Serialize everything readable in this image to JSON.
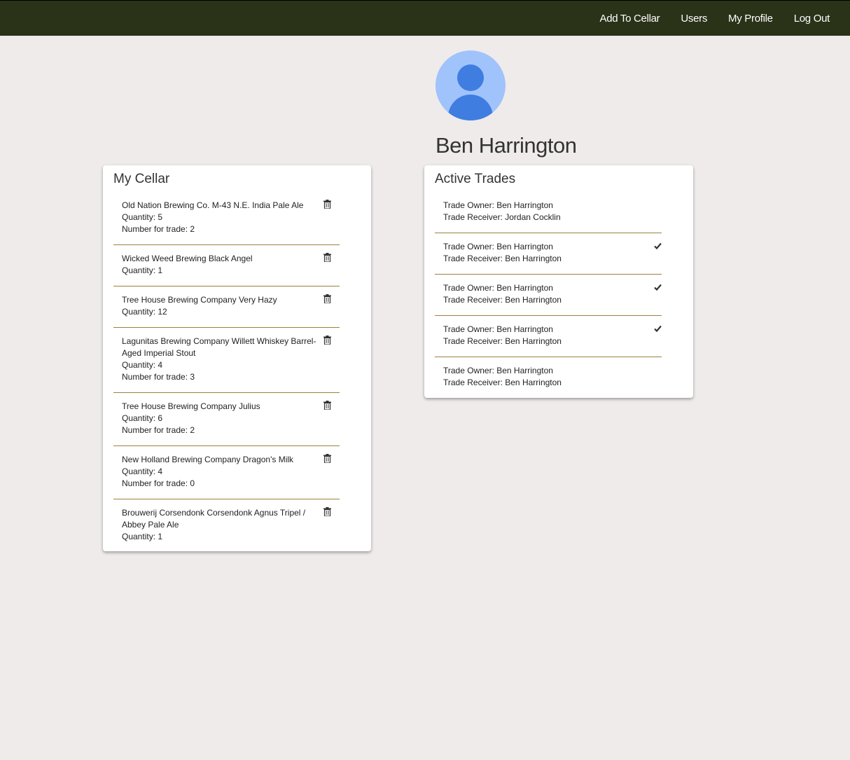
{
  "nav": {
    "links": [
      "Add To Cellar",
      "Users",
      "My Profile",
      "Log Out"
    ]
  },
  "profile": {
    "name": "Ben Harrington"
  },
  "cellar": {
    "title": "My Cellar",
    "items": [
      {
        "name": "Old Nation Brewing Co. M-43 N.E. India Pale Ale",
        "quantity": "Quantity: 5",
        "trade": "Number for trade: 2"
      },
      {
        "name": "Wicked Weed Brewing Black Angel",
        "quantity": "Quantity: 1",
        "trade": ""
      },
      {
        "name": "Tree House Brewing Company Very Hazy",
        "quantity": "Quantity: 12",
        "trade": ""
      },
      {
        "name": "Lagunitas Brewing Company Willett Whiskey Barrel-Aged Imperial Stout",
        "quantity": "Quantity: 4",
        "trade": "Number for trade: 3"
      },
      {
        "name": "Tree House Brewing Company Julius",
        "quantity": "Quantity: 6",
        "trade": "Number for trade: 2"
      },
      {
        "name": "New Holland Brewing Company Dragon's Milk",
        "quantity": "Quantity: 4",
        "trade": "Number for trade: 0"
      },
      {
        "name": "Brouwerij Corsendonk Corsendonk Agnus Tripel / Abbey Pale Ale",
        "quantity": "Quantity: 1",
        "trade": ""
      }
    ],
    "trash_icon": "trash-icon"
  },
  "trades": {
    "title": "Active Trades",
    "items": [
      {
        "owner": "Trade Owner: Ben Harrington",
        "receiver": "Trade Receiver: Jordan Cocklin",
        "checked": false
      },
      {
        "owner": "Trade Owner: Ben Harrington",
        "receiver": "Trade Receiver: Ben Harrington",
        "checked": true
      },
      {
        "owner": "Trade Owner: Ben Harrington",
        "receiver": "Trade Receiver: Ben Harrington",
        "checked": true
      },
      {
        "owner": "Trade Owner: Ben Harrington",
        "receiver": "Trade Receiver: Ben Harrington",
        "checked": true
      },
      {
        "owner": "Trade Owner: Ben Harrington",
        "receiver": "Trade Receiver: Ben Harrington",
        "checked": false
      }
    ],
    "check_icon": "check-icon"
  },
  "colors": {
    "navbar": "#2a3218",
    "background": "#efebea",
    "divider": "#9a8140",
    "avatar_bg": "#a1c3fb",
    "avatar_fg": "#3f7de0"
  }
}
